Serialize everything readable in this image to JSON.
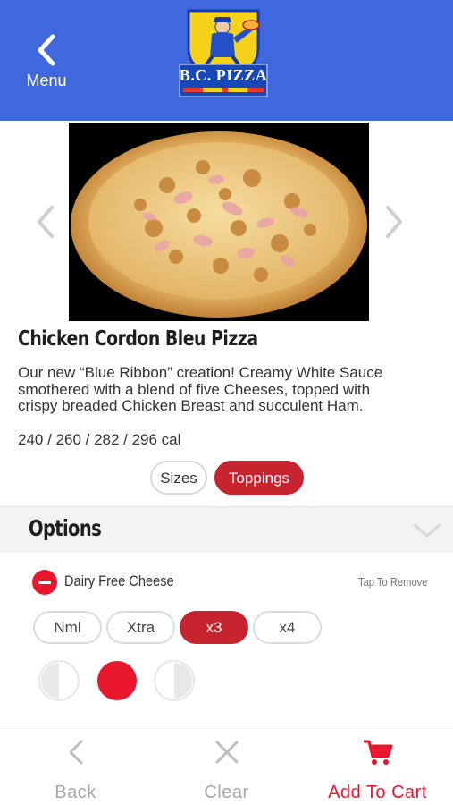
{
  "header": {
    "menu_label": "Menu",
    "logo_text": "B.C. PIZZA",
    "brand_color": "#3f68df"
  },
  "product": {
    "title": "Chicken Cordon Bleu Pizza",
    "description": "Our new “Blue Ribbon” creation! Creamy White Sauce smothered with a blend of five Cheeses, topped with crispy breaded Chicken Breast and succulent Ham.",
    "calories": "240 / 260 / 282 / 296 cal"
  },
  "tabs": [
    {
      "label": "Sizes",
      "active": false
    },
    {
      "label": "Toppings",
      "active": true
    }
  ],
  "options": {
    "title": "Options",
    "topping": {
      "name": "Dairy Free Cheese",
      "action_hint": "Tap To Remove"
    },
    "amounts": [
      {
        "label": "Nml",
        "selected": false
      },
      {
        "label": "Xtra",
        "selected": false
      },
      {
        "label": "x3",
        "selected": true
      },
      {
        "label": "x4",
        "selected": false
      }
    ],
    "portions": [
      {
        "name": "left-half",
        "selected": false
      },
      {
        "name": "whole",
        "selected": true
      },
      {
        "name": "right-half",
        "selected": false
      }
    ]
  },
  "toolbar": {
    "back_label": "Back",
    "clear_label": "Clear",
    "cart_label": "Add To Cart"
  },
  "colors": {
    "accent_red": "#c8242f",
    "cart_red": "#e8172e",
    "header_blue": "#3f68df"
  }
}
